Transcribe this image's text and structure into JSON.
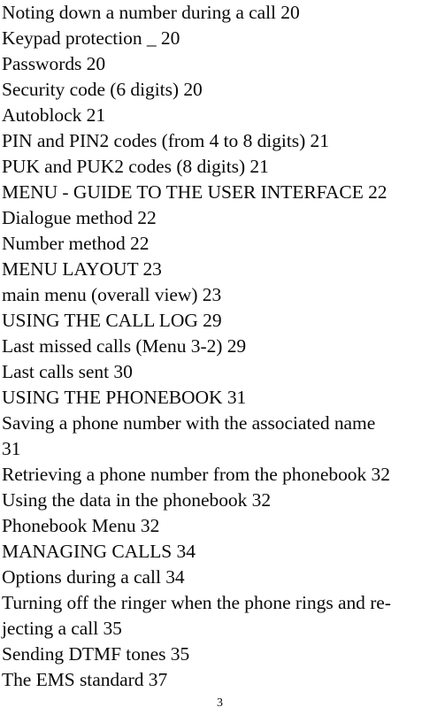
{
  "document": {
    "type": "table-of-contents",
    "page_number": "3",
    "background_color": "#ffffff",
    "text_color": "#000000",
    "entries": [
      {
        "text": "Noting down a number during a call 20"
      },
      {
        "text": "Keypad protection _ 20"
      },
      {
        "text": "Passwords 20"
      },
      {
        "text": "Security code (6 digits) 20"
      },
      {
        "text": "Autoblock 21"
      },
      {
        "text": "PIN and PIN2 codes (from 4 to 8 digits) 21"
      },
      {
        "text": "PUK and PUK2 codes (8 digits) 21"
      },
      {
        "text": "MENU - GUIDE TO THE USER INTERFACE 22"
      },
      {
        "text": "Dialogue method 22"
      },
      {
        "text": "Number method 22"
      },
      {
        "text": "MENU LAYOUT 23"
      },
      {
        "text": "main menu (overall view) 23"
      },
      {
        "text": "USING THE CALL LOG 29"
      },
      {
        "text": "Last missed calls (Menu 3-2) 29"
      },
      {
        "text": "Last calls sent 30"
      },
      {
        "text": "USING THE PHONEBOOK 31"
      },
      {
        "text": "Saving a phone number with the associated name"
      },
      {
        "text": "31"
      },
      {
        "text": "Retrieving a phone number from the phonebook 32"
      },
      {
        "text": "Using the data in the phonebook 32"
      },
      {
        "text": "Phonebook Menu 32"
      },
      {
        "text": "MANAGING CALLS 34"
      },
      {
        "text": "Options during a call 34"
      },
      {
        "text": "Turning off the ringer when the phone rings and re-"
      },
      {
        "text": "jecting a call 35"
      },
      {
        "text": "Sending DTMF tones 35"
      },
      {
        "text": "The EMS standard 37"
      }
    ]
  }
}
